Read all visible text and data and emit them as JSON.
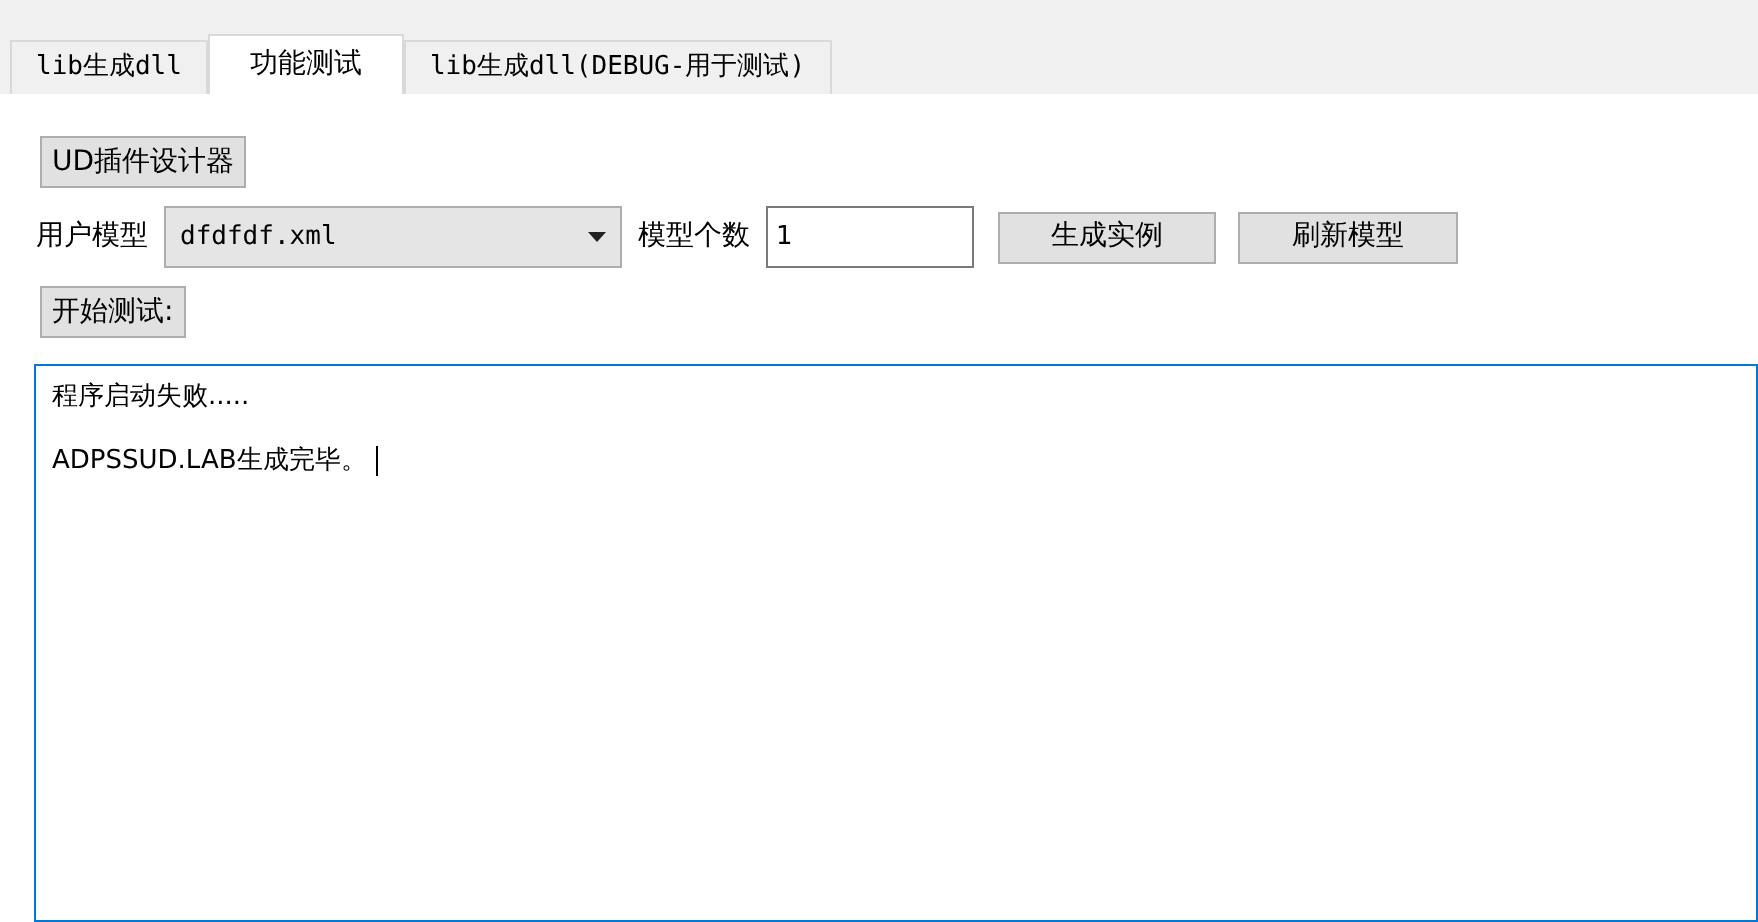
{
  "tabs": [
    {
      "label": "lib生成dll",
      "selected": false
    },
    {
      "label": "功能测试",
      "selected": true
    },
    {
      "label": "lib生成dll(DEBUG-用于测试)",
      "selected": false
    }
  ],
  "designer_button": "UD插件设计器",
  "model_label": "用户模型",
  "model_select": {
    "value": "dfdfdf.xml"
  },
  "count_label": "模型个数",
  "count_field": {
    "value": "1"
  },
  "generate_button": "生成实例",
  "refresh_button": "刷新模型",
  "start_button": "开始测试:",
  "output": {
    "lines": [
      "程序启动失败.....",
      "ADPSSUD.LAB生成完毕。"
    ],
    "focused": true
  }
}
